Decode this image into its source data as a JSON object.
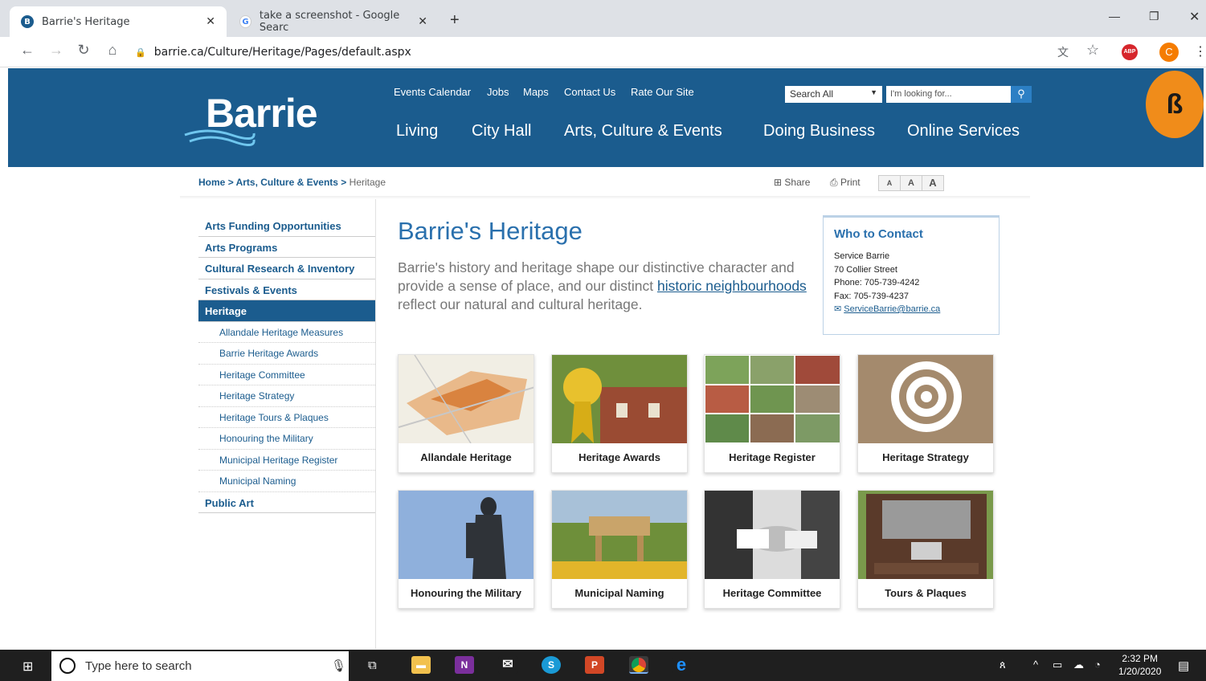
{
  "browser": {
    "tabs": [
      {
        "title": "Barrie's Heritage",
        "icon": "barrie-favicon"
      },
      {
        "title": "take a screenshot - Google Searc",
        "icon": "google-favicon"
      }
    ],
    "url": "barrie.ca/Culture/Heritage/Pages/default.aspx"
  },
  "site": {
    "logo": "Barrie",
    "utility_links": [
      "Events Calendar",
      "Jobs",
      "Maps",
      "Contact Us",
      "Rate Our Site"
    ],
    "search_select": "Search All",
    "search_placeholder": "I'm looking for...",
    "main_nav": [
      "Living",
      "City Hall",
      "Arts, Culture & Events",
      "Doing Business",
      "Online Services"
    ]
  },
  "breadcrumb": {
    "home": "Home",
    "sep": ">",
    "section": "Arts, Culture & Events",
    "current": "Heritage"
  },
  "tools": {
    "share": "Share",
    "print": "Print",
    "sizes": [
      "A",
      "A",
      "A"
    ]
  },
  "sidebar": {
    "items": [
      "Arts Funding Opportunities",
      "Arts Programs",
      "Cultural Research & Inventory",
      "Festivals & Events",
      "Heritage"
    ],
    "sub_items": [
      "Allandale Heritage Measures",
      "Barrie Heritage Awards",
      "Heritage Committee",
      "Heritage Strategy",
      "Heritage Tours & Plaques",
      "Honouring the Military",
      "Municipal Heritage Register",
      "Municipal Naming"
    ],
    "last_item": "Public Art"
  },
  "main": {
    "title": "Barrie's Heritage",
    "intro_1": "Barrie's history and heritage shape our distinctive character and provide a sense of place, and our distinct ",
    "intro_link": "historic neighbourhoods",
    "intro_2": " reflect our natural and cultural heritage."
  },
  "contact": {
    "heading": "Who to Contact",
    "name": "Service Barrie",
    "address": "70 Collier Street",
    "phone": "Phone: 705-739-4242",
    "fax": "Fax: 705-739-4237",
    "email": "ServiceBarrie@barrie.ca"
  },
  "cards": [
    "Allandale Heritage",
    "Heritage Awards",
    "Heritage Register",
    "Heritage Strategy",
    "Honouring the Military",
    "Municipal Naming",
    "Heritage Committee",
    "Tours & Plaques"
  ],
  "taskbar": {
    "search_placeholder": "Type here to search",
    "time": "2:32 PM",
    "date": "1/20/2020"
  },
  "colors": {
    "brand": "#1b5c8e",
    "accent": "#2a70ad"
  }
}
